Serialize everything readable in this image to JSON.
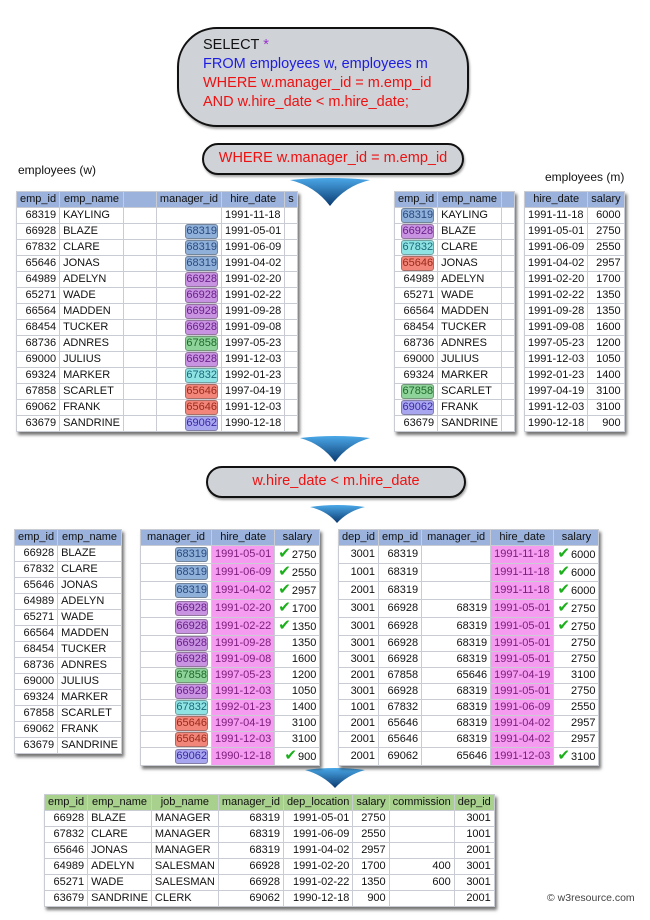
{
  "sql": {
    "select_kw": "SELECT",
    "select_star": "*",
    "from_line": "FROM employees w, employees m",
    "where_line": "WHERE w.manager_id = m.emp_id",
    "and_line": "AND w.hire_date < m.hire_date;"
  },
  "conditions": {
    "first": "WHERE w.manager_id  = m.emp_id",
    "second": "w.hire_date  < m.hire_date"
  },
  "labels": {
    "w_table": "employees (w)",
    "m_table": "employees (m)"
  },
  "colors": {
    "header_blue": "#9bb3dc",
    "header_green": "#a9d18e",
    "hire_date_pink": "#f59cf0",
    "text_red": "#ee1111",
    "text_blue": "#1d1de0",
    "check_green": "#1bb01b"
  },
  "table_w": {
    "headers": [
      "emp_id",
      "emp_name",
      "",
      "manager_id",
      "hire_date",
      "s"
    ],
    "rows": [
      {
        "emp_id": "68319",
        "emp_name": "KAYLING",
        "manager_id": "",
        "hire_date": "1991-11-18",
        "hl": ""
      },
      {
        "emp_id": "66928",
        "emp_name": "BLAZE",
        "manager_id": "68319",
        "hire_date": "1991-05-01",
        "hl": "blue"
      },
      {
        "emp_id": "67832",
        "emp_name": "CLARE",
        "manager_id": "68319",
        "hire_date": "1991-06-09",
        "hl": "blue"
      },
      {
        "emp_id": "65646",
        "emp_name": "JONAS",
        "manager_id": "68319",
        "hire_date": "1991-04-02",
        "hl": "blue"
      },
      {
        "emp_id": "64989",
        "emp_name": "ADELYN",
        "manager_id": "66928",
        "hire_date": "1991-02-20",
        "hl": "purple"
      },
      {
        "emp_id": "65271",
        "emp_name": "WADE",
        "manager_id": "66928",
        "hire_date": "1991-02-22",
        "hl": "purple"
      },
      {
        "emp_id": "66564",
        "emp_name": "MADDEN",
        "manager_id": "66928",
        "hire_date": "1991-09-28",
        "hl": "purple"
      },
      {
        "emp_id": "68454",
        "emp_name": "TUCKER",
        "manager_id": "66928",
        "hire_date": "1991-09-08",
        "hl": "purple"
      },
      {
        "emp_id": "68736",
        "emp_name": "ADNRES",
        "manager_id": "67858",
        "hire_date": "1997-05-23",
        "hl": "green"
      },
      {
        "emp_id": "69000",
        "emp_name": "JULIUS",
        "manager_id": "66928",
        "hire_date": "1991-12-03",
        "hl": "purple"
      },
      {
        "emp_id": "69324",
        "emp_name": "MARKER",
        "manager_id": "67832",
        "hire_date": "1992-01-23",
        "hl": "cyan"
      },
      {
        "emp_id": "67858",
        "emp_name": "SCARLET",
        "manager_id": "65646",
        "hire_date": "1997-04-19",
        "hl": "red"
      },
      {
        "emp_id": "69062",
        "emp_name": "FRANK",
        "manager_id": "65646",
        "hire_date": "1991-12-03",
        "hl": "red"
      },
      {
        "emp_id": "63679",
        "emp_name": "SANDRINE",
        "manager_id": "69062",
        "hire_date": "1990-12-18",
        "hl": "indigo"
      }
    ]
  },
  "table_m_left": {
    "headers": [
      "emp_id",
      "emp_name",
      ""
    ],
    "rows": [
      {
        "emp_id": "68319",
        "emp_name": "KAYLING",
        "hl": "blue"
      },
      {
        "emp_id": "66928",
        "emp_name": "BLAZE",
        "hl": "purple"
      },
      {
        "emp_id": "67832",
        "emp_name": "CLARE",
        "hl": "cyan"
      },
      {
        "emp_id": "65646",
        "emp_name": "JONAS",
        "hl": "red"
      },
      {
        "emp_id": "64989",
        "emp_name": "ADELYN",
        "hl": ""
      },
      {
        "emp_id": "65271",
        "emp_name": "WADE",
        "hl": ""
      },
      {
        "emp_id": "66564",
        "emp_name": "MADDEN",
        "hl": ""
      },
      {
        "emp_id": "68454",
        "emp_name": "TUCKER",
        "hl": ""
      },
      {
        "emp_id": "68736",
        "emp_name": "ADNRES",
        "hl": ""
      },
      {
        "emp_id": "69000",
        "emp_name": "JULIUS",
        "hl": ""
      },
      {
        "emp_id": "69324",
        "emp_name": "MARKER",
        "hl": ""
      },
      {
        "emp_id": "67858",
        "emp_name": "SCARLET",
        "hl": "green"
      },
      {
        "emp_id": "69062",
        "emp_name": "FRANK",
        "hl": "indigo"
      },
      {
        "emp_id": "63679",
        "emp_name": "SANDRINE",
        "hl": ""
      }
    ]
  },
  "table_m_right": {
    "headers": [
      "hire_date",
      "salary"
    ],
    "rows": [
      {
        "hire_date": "1991-11-18",
        "salary": "6000"
      },
      {
        "hire_date": "1991-05-01",
        "salary": "2750"
      },
      {
        "hire_date": "1991-06-09",
        "salary": "2550"
      },
      {
        "hire_date": "1991-04-02",
        "salary": "2957"
      },
      {
        "hire_date": "1991-02-20",
        "salary": "1700"
      },
      {
        "hire_date": "1991-02-22",
        "salary": "1350"
      },
      {
        "hire_date": "1991-09-28",
        "salary": "1350"
      },
      {
        "hire_date": "1991-09-08",
        "salary": "1600"
      },
      {
        "hire_date": "1997-05-23",
        "salary": "1200"
      },
      {
        "hire_date": "1991-12-03",
        "salary": "1050"
      },
      {
        "hire_date": "1992-01-23",
        "salary": "1400"
      },
      {
        "hire_date": "1997-04-19",
        "salary": "3100"
      },
      {
        "hire_date": "1991-12-03",
        "salary": "3100"
      },
      {
        "hire_date": "1990-12-18",
        "salary": "900"
      }
    ]
  },
  "joined_w_left": {
    "headers": [
      "emp_id",
      "emp_name"
    ],
    "rows": [
      {
        "emp_id": "66928",
        "emp_name": "BLAZE"
      },
      {
        "emp_id": "67832",
        "emp_name": "CLARE"
      },
      {
        "emp_id": "65646",
        "emp_name": "JONAS"
      },
      {
        "emp_id": "64989",
        "emp_name": "ADELYN"
      },
      {
        "emp_id": "65271",
        "emp_name": "WADE"
      },
      {
        "emp_id": "66564",
        "emp_name": "MADDEN"
      },
      {
        "emp_id": "68454",
        "emp_name": "TUCKER"
      },
      {
        "emp_id": "68736",
        "emp_name": "ADNRES"
      },
      {
        "emp_id": "69000",
        "emp_name": "JULIUS"
      },
      {
        "emp_id": "69324",
        "emp_name": "MARKER"
      },
      {
        "emp_id": "67858",
        "emp_name": "SCARLET"
      },
      {
        "emp_id": "69062",
        "emp_name": "FRANK"
      },
      {
        "emp_id": "63679",
        "emp_name": "SANDRINE"
      }
    ]
  },
  "joined_w_right": {
    "headers": [
      "manager_id",
      "hire_date",
      "salary"
    ],
    "rows": [
      {
        "manager_id": "68319",
        "hire_date": "1991-05-01",
        "salary": "2750",
        "hl": "blue",
        "check": true
      },
      {
        "manager_id": "68319",
        "hire_date": "1991-06-09",
        "salary": "2550",
        "hl": "blue",
        "check": true
      },
      {
        "manager_id": "68319",
        "hire_date": "1991-04-02",
        "salary": "2957",
        "hl": "blue",
        "check": true
      },
      {
        "manager_id": "66928",
        "hire_date": "1991-02-20",
        "salary": "1700",
        "hl": "purple",
        "check": true
      },
      {
        "manager_id": "66928",
        "hire_date": "1991-02-22",
        "salary": "1350",
        "hl": "purple",
        "check": true
      },
      {
        "manager_id": "66928",
        "hire_date": "1991-09-28",
        "salary": "1350",
        "hl": "purple",
        "check": false
      },
      {
        "manager_id": "66928",
        "hire_date": "1991-09-08",
        "salary": "1600",
        "hl": "purple",
        "check": false
      },
      {
        "manager_id": "67858",
        "hire_date": "1997-05-23",
        "salary": "1200",
        "hl": "green",
        "check": false
      },
      {
        "manager_id": "66928",
        "hire_date": "1991-12-03",
        "salary": "1050",
        "hl": "purple",
        "check": false
      },
      {
        "manager_id": "67832",
        "hire_date": "1992-01-23",
        "salary": "1400",
        "hl": "cyan",
        "check": false
      },
      {
        "manager_id": "65646",
        "hire_date": "1997-04-19",
        "salary": "3100",
        "hl": "red",
        "check": false
      },
      {
        "manager_id": "65646",
        "hire_date": "1991-12-03",
        "salary": "3100",
        "hl": "red",
        "check": false
      },
      {
        "manager_id": "69062",
        "hire_date": "1990-12-18",
        "salary": "900",
        "hl": "indigo",
        "check": true
      }
    ]
  },
  "joined_m": {
    "headers": [
      "dep_id",
      "emp_id",
      "manager_id",
      "hire_date",
      "salary"
    ],
    "rows": [
      {
        "dep_id": "3001",
        "emp_id": "68319",
        "manager_id": "",
        "hire_date": "1991-11-18",
        "salary": "6000",
        "check": true
      },
      {
        "dep_id": "1001",
        "emp_id": "68319",
        "manager_id": "",
        "hire_date": "1991-11-18",
        "salary": "6000",
        "check": true
      },
      {
        "dep_id": "2001",
        "emp_id": "68319",
        "manager_id": "",
        "hire_date": "1991-11-18",
        "salary": "6000",
        "check": true
      },
      {
        "dep_id": "3001",
        "emp_id": "66928",
        "manager_id": "68319",
        "hire_date": "1991-05-01",
        "salary": "2750",
        "check": true
      },
      {
        "dep_id": "3001",
        "emp_id": "66928",
        "manager_id": "68319",
        "hire_date": "1991-05-01",
        "salary": "2750",
        "check": true
      },
      {
        "dep_id": "3001",
        "emp_id": "66928",
        "manager_id": "68319",
        "hire_date": "1991-05-01",
        "salary": "2750",
        "check": false
      },
      {
        "dep_id": "3001",
        "emp_id": "66928",
        "manager_id": "68319",
        "hire_date": "1991-05-01",
        "salary": "2750",
        "check": false
      },
      {
        "dep_id": "2001",
        "emp_id": "67858",
        "manager_id": "65646",
        "hire_date": "1997-04-19",
        "salary": "3100",
        "check": false
      },
      {
        "dep_id": "3001",
        "emp_id": "66928",
        "manager_id": "68319",
        "hire_date": "1991-05-01",
        "salary": "2750",
        "check": false
      },
      {
        "dep_id": "1001",
        "emp_id": "67832",
        "manager_id": "68319",
        "hire_date": "1991-06-09",
        "salary": "2550",
        "check": false
      },
      {
        "dep_id": "2001",
        "emp_id": "65646",
        "manager_id": "68319",
        "hire_date": "1991-04-02",
        "salary": "2957",
        "check": false
      },
      {
        "dep_id": "2001",
        "emp_id": "65646",
        "manager_id": "68319",
        "hire_date": "1991-04-02",
        "salary": "2957",
        "check": false
      },
      {
        "dep_id": "2001",
        "emp_id": "69062",
        "manager_id": "65646",
        "hire_date": "1991-12-03",
        "salary": "3100",
        "check": true
      }
    ]
  },
  "result": {
    "headers": [
      "emp_id",
      "emp_name",
      "job_name",
      "manager_id",
      "dep_location",
      "salary",
      "commission",
      "dep_id"
    ],
    "rows": [
      {
        "emp_id": "66928",
        "emp_name": "BLAZE",
        "job_name": "MANAGER",
        "manager_id": "68319",
        "dep_location": "1991-05-01",
        "salary": "2750",
        "commission": "",
        "dep_id": "3001"
      },
      {
        "emp_id": "67832",
        "emp_name": "CLARE",
        "job_name": "MANAGER",
        "manager_id": "68319",
        "dep_location": "1991-06-09",
        "salary": "2550",
        "commission": "",
        "dep_id": "1001"
      },
      {
        "emp_id": "65646",
        "emp_name": "JONAS",
        "job_name": "MANAGER",
        "manager_id": "68319",
        "dep_location": "1991-04-02",
        "salary": "2957",
        "commission": "",
        "dep_id": "2001"
      },
      {
        "emp_id": "64989",
        "emp_name": "ADELYN",
        "job_name": "SALESMAN",
        "manager_id": "66928",
        "dep_location": "1991-02-20",
        "salary": "1700",
        "commission": "400",
        "dep_id": "3001"
      },
      {
        "emp_id": "65271",
        "emp_name": "WADE",
        "job_name": "SALESMAN",
        "manager_id": "66928",
        "dep_location": "1991-02-22",
        "salary": "1350",
        "commission": "600",
        "dep_id": "3001"
      },
      {
        "emp_id": "63679",
        "emp_name": "SANDRINE",
        "job_name": "CLERK",
        "manager_id": "69062",
        "dep_location": "1990-12-18",
        "salary": "900",
        "commission": "",
        "dep_id": "2001"
      }
    ]
  },
  "footer": {
    "copyright": "© w3resource.com"
  }
}
